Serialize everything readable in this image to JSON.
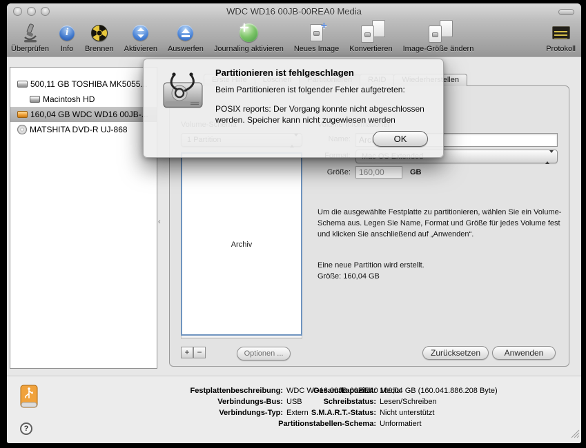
{
  "window": {
    "title": "WDC WD16 00JB-00REA0 Media"
  },
  "toolbar": {
    "items": [
      {
        "label": "Überprüfen",
        "icon": "microscope-icon"
      },
      {
        "label": "Info",
        "icon": "info-icon"
      },
      {
        "label": "Brennen",
        "icon": "burn-icon"
      },
      {
        "label": "Aktivieren",
        "icon": "mount-icon"
      },
      {
        "label": "Auswerfen",
        "icon": "eject-icon"
      },
      {
        "label": "Journaling aktivieren",
        "icon": "journaling-icon"
      },
      {
        "label": "Neues Image",
        "icon": "new-image-icon"
      },
      {
        "label": "Konvertieren",
        "icon": "convert-image-icon"
      },
      {
        "label": "Image-Größe ändern",
        "icon": "resize-image-icon"
      },
      {
        "label": "Protokoll",
        "icon": "log-icon"
      }
    ]
  },
  "sidebar": {
    "items": [
      {
        "label": "500,11 GB TOSHIBA MK5055...",
        "icon": "internal-disk-icon",
        "selected": false
      },
      {
        "label": "Macintosh HD",
        "icon": "volume-icon",
        "selected": false
      },
      {
        "label": "160,04 GB WDC WD16 00JB-...",
        "icon": "external-disk-icon",
        "selected": true
      },
      {
        "label": "MATSHITA DVD-R UJ-868",
        "icon": "optical-drive-icon",
        "selected": false
      }
    ]
  },
  "tabs": [
    {
      "label": "Erste Hilfe",
      "selected": false
    },
    {
      "label": "Löschen",
      "selected": false
    },
    {
      "label": "Partitionieren",
      "selected": true
    },
    {
      "label": "RAID",
      "selected": false
    },
    {
      "label": "Wiederherstellen",
      "selected": false
    }
  ],
  "partition_pane": {
    "volume_scheme_label": "Volume-Schema",
    "scheme_value": "1 Partition",
    "partition_box_label": "Archiv",
    "add_label": "+",
    "remove_label": "−",
    "options_label": "Optionen ...",
    "volume_info_label": "Volume-Informationen",
    "name_label": "Name:",
    "name_value": "Archiv",
    "format_label": "Format:",
    "format_value": "Mac OS Extended",
    "size_label": "Größe:",
    "size_value": "160,00",
    "size_unit": "GB",
    "help_text": "Um die ausgewählte Festplatte zu partitionieren, wählen Sie ein Volume-Schema aus. Legen Sie Name, Format und Größe für jedes Volume fest und klicken Sie anschließend auf „Anwenden“.",
    "status_line1": "Eine neue Partition wird erstellt.",
    "status_line2": "Größe: 160,04 GB",
    "reset_label": "Zurücksetzen",
    "apply_label": "Anwenden"
  },
  "dialog": {
    "title": "Partitionieren ist fehlgeschlagen",
    "message": "Beim Partitionieren ist folgender Fehler aufgetreten:",
    "detail": "POSIX reports: Der Vorgang konnte nicht abgeschlossen werden. Speicher kann nicht zugewiesen werden",
    "ok_label": "OK",
    "icon": "disk-utility-alert-icon"
  },
  "info_panel": {
    "left": [
      {
        "label": "Festplattenbeschreibung:",
        "value": "WDC WD16 00JB-00REA0 Media"
      },
      {
        "label": "Verbindungs-Bus:",
        "value": "USB"
      },
      {
        "label": "Verbindungs-Typ:",
        "value": "Extern"
      }
    ],
    "right": [
      {
        "label": "Gesamtkapazität:",
        "value": "160,04 GB (160.041.886.208 Byte)"
      },
      {
        "label": "Schreibstatus:",
        "value": "Lesen/Schreiben"
      },
      {
        "label": "S.M.A.R.T.-Status:",
        "value": "Nicht unterstützt"
      },
      {
        "label": "Partitionstabellen-Schema:",
        "value": "Unformatiert"
      }
    ],
    "help_label": "?"
  },
  "colors": {
    "partition_border_blue": "#6f94bf",
    "external_drive_orange": "#f0a23c",
    "journaling_green": "#5fae46",
    "log_warning_yellow": "#e0c84a"
  }
}
